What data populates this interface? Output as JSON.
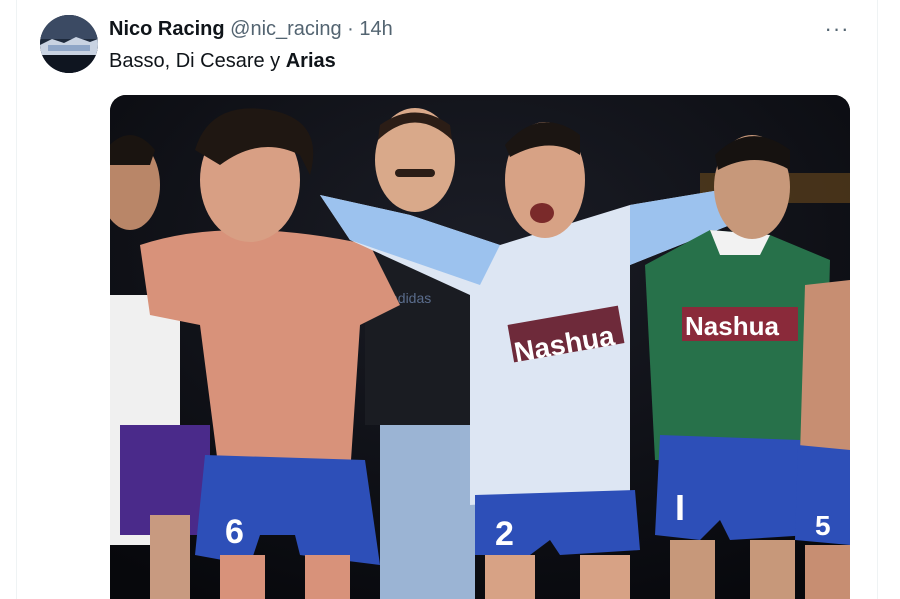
{
  "tweet": {
    "author_name": "Nico Racing",
    "handle": "@nic_racing",
    "separator": "·",
    "time": "14h",
    "more_label": "···",
    "text_prefix": "Basso, Di Cesare y ",
    "text_bold": "Arias"
  },
  "media": {
    "sponsor_text": "Nashua",
    "shirt_text": "adidas",
    "numbers": [
      "6",
      "2",
      "I",
      "5"
    ]
  },
  "colors": {
    "text_primary": "#0f1419",
    "text_secondary": "#536471",
    "border": "#eff3f4"
  },
  "icons": {
    "more": "more-horizontal-icon"
  }
}
